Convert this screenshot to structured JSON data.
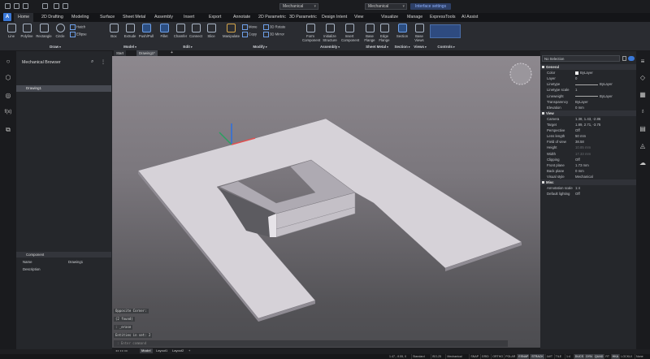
{
  "quick_access": {
    "workspace": "Mechanical",
    "profile": "Mechanical",
    "interface_settings": "Interface settings"
  },
  "ribbon_tabs": [
    "Home",
    "2D Drafting",
    "Modeling",
    "Surface",
    "Sheet Metal",
    "Assembly",
    "Insert",
    "Export",
    "Annotate",
    "2D Parametric",
    "3D Parametric",
    "Design Intent",
    "View",
    "Visualize",
    "Manage",
    "ExpressTools",
    "AI Assist"
  ],
  "ribbon_tools": {
    "line": "Line",
    "polyline": "Polyline",
    "rectangle": "Rectangle",
    "circle": "Circle",
    "hatch": "Hatch",
    "ellipse": "Ellipse",
    "box": "Box",
    "extrude": "Extrude",
    "pushpull": "Push/Pull",
    "fillet": "Fillet",
    "chamfer": "Chamfer",
    "connect": "Connect",
    "slice": "Slice",
    "manipulate": "Manipulate",
    "move": "Move",
    "copy": "Copy",
    "rotate3d": "3D Rotate",
    "mirror3d": "3D Mirror",
    "form_component": "Form Component",
    "initialize_structure": "Initialize Structure",
    "insert_component": "Insert Component",
    "base_flange": "Base Flange",
    "edge_flange": "Edge Flange",
    "section": "Section",
    "base_views": "Base Views"
  },
  "ribbon_groups": {
    "draw": "Draw",
    "model": "Model",
    "edit": "Edit",
    "modify": "Modify",
    "assembly": "Assembly",
    "sheet_metal": "Sheet Metal",
    "section": "Section",
    "views": "Views",
    "controls": "Controls"
  },
  "doc_tabs": [
    "Start",
    "Drawing1*"
  ],
  "browser": {
    "title": "Mechanical Browser",
    "tree_item": "Drawing1",
    "component_header": "Component",
    "rows": [
      {
        "label": "Name",
        "value": "Drawing1"
      },
      {
        "label": "Description",
        "value": ""
      }
    ]
  },
  "properties": {
    "selection": "No Selection",
    "rows": [
      {
        "type": "section",
        "label": "General"
      },
      {
        "label": "Color",
        "value": "ByLayer"
      },
      {
        "label": "Layer",
        "value": "0"
      },
      {
        "label": "Linetype",
        "value": "ByLayer",
        "line": true
      },
      {
        "label": "Linetype scale",
        "value": "1"
      },
      {
        "label": "Lineweight",
        "value": "ByLayer",
        "line": true
      },
      {
        "label": "Transparency",
        "value": "ByLayer"
      },
      {
        "label": "Elevation",
        "value": "0 mm"
      },
      {
        "type": "section",
        "label": "View"
      },
      {
        "label": "Camera",
        "value": "1.38, 1.43, -2.86"
      },
      {
        "label": "Target",
        "value": "1.89, 2.71, -3.75"
      },
      {
        "label": "Perspective",
        "value": "Off"
      },
      {
        "label": "Lens length",
        "value": "50 mm"
      },
      {
        "label": "Field of view",
        "value": "38.58"
      },
      {
        "label": "Height",
        "value": "10.85 mm",
        "dim": true
      },
      {
        "label": "Width",
        "value": "17.33 mm",
        "dim": true
      },
      {
        "label": "Clipping",
        "value": "Off"
      },
      {
        "label": "Front plane",
        "value": "1.73 mm"
      },
      {
        "label": "Back plane",
        "value": "0 mm"
      },
      {
        "label": "Visual style",
        "value": "Mechanical"
      },
      {
        "type": "section",
        "label": "Misc"
      },
      {
        "label": "Annotation scale",
        "value": "1:4"
      },
      {
        "label": "Default lighting",
        "value": "Off"
      }
    ]
  },
  "command_history": [
    "Opposite Corner:",
    "(2 found)",
    ": _erase",
    "Entities in set: 2"
  ],
  "command_placeholder": ": Enter command",
  "layout_tabs": [
    "Model",
    "Layout1",
    "Layout2",
    "+"
  ],
  "status_bar": {
    "coords": "1.47, -9.55, 0",
    "items": [
      "Standard",
      "ISO-25",
      "Mechanical",
      "SNAP",
      "GRID",
      "ORTHO",
      "POLAR",
      "ESNAP",
      "STRACK",
      "LWT",
      "TILE",
      "1:4",
      "DUCS",
      "DYN",
      "QUAD",
      "RT",
      "HKA",
      "LOCKUI",
      "None"
    ],
    "active": [
      "ESNAP",
      "STRACK",
      "DUCS",
      "DYN",
      "QUAD",
      "HKA"
    ]
  },
  "colors": {
    "accent": "#3a78d8",
    "viewport_top": "#8d888e",
    "viewport_bottom": "#4c4c50",
    "part": "#d6d2d8"
  }
}
